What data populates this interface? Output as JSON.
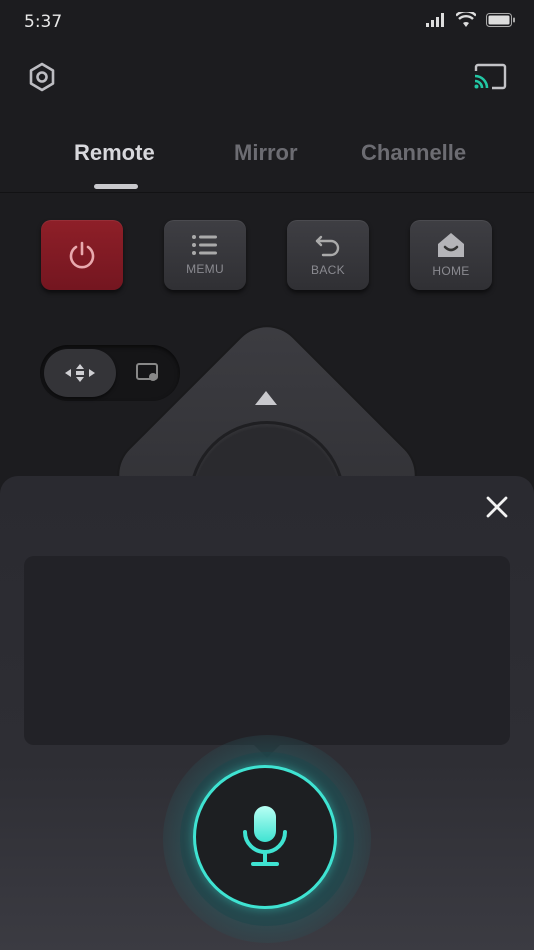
{
  "status_bar": {
    "time": "5:37"
  },
  "header": {
    "settings_icon": "gear-hex-icon",
    "cast_icon": "cast-icon",
    "cast_color": "#22c7a4"
  },
  "tabs": [
    {
      "label": "Remote",
      "active": true
    },
    {
      "label": "Mirror",
      "active": false
    },
    {
      "label": "Channelle",
      "active": false
    }
  ],
  "remote": {
    "power_color": "#8e1f28",
    "menu_label": "MEMU",
    "back_label": "BACK",
    "home_label": "HOME"
  },
  "voice": {
    "accent": "#3fe3d2",
    "mic_icon": "microphone-icon",
    "close_icon": "close-icon"
  }
}
